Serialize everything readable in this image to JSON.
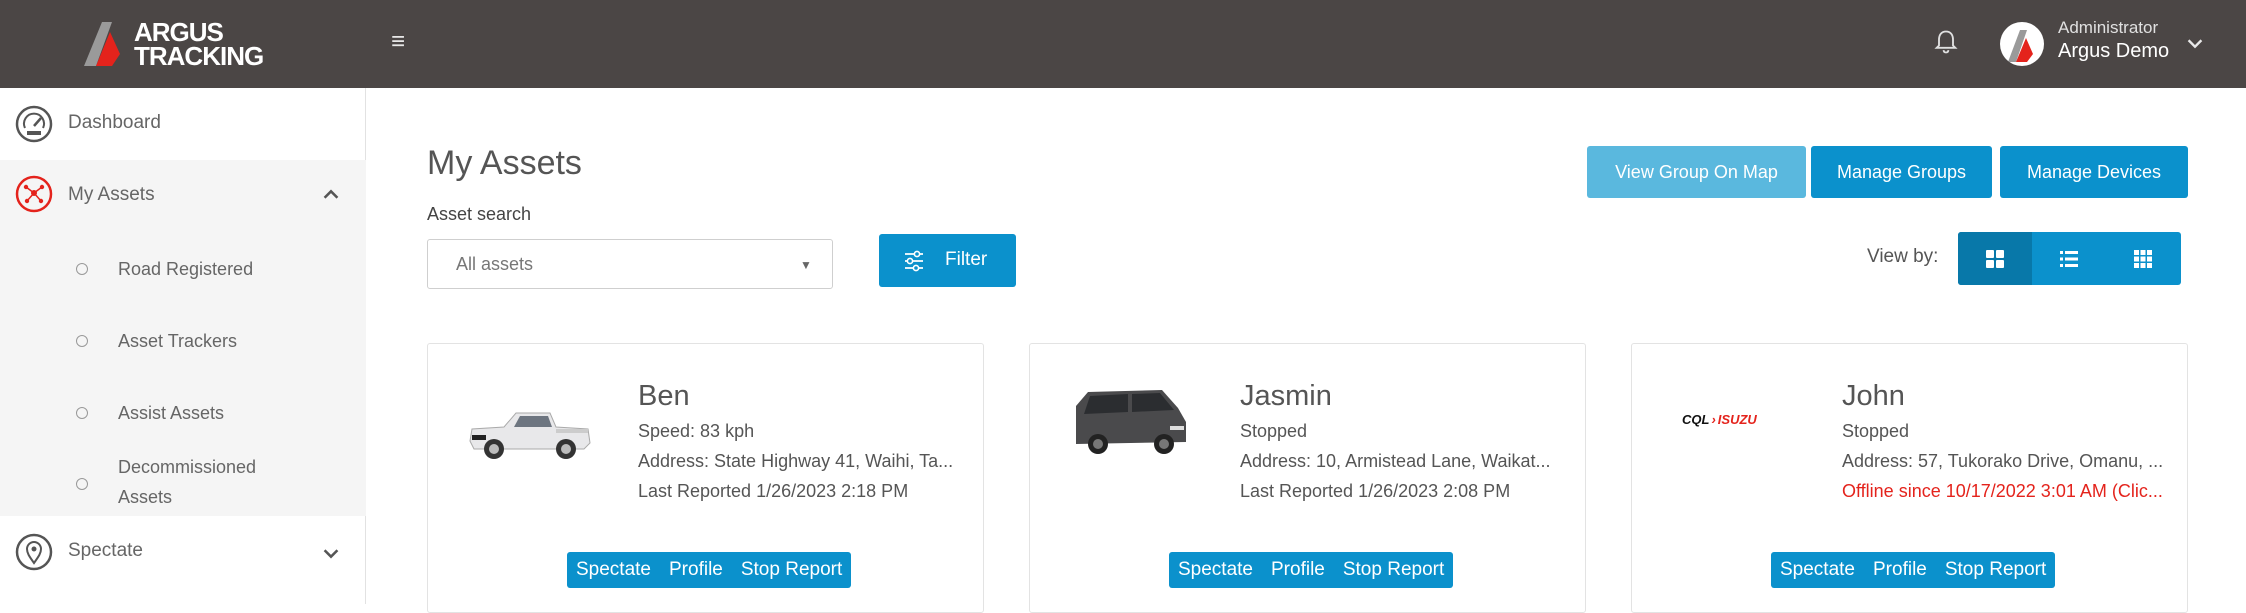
{
  "header": {
    "logo_line1": "ARGUS",
    "logo_line2": "TRACKING",
    "user_role": "Administrator",
    "user_name": "Argus Demo",
    "colors": {
      "bar": "#4b4645",
      "accent": "#e4231c"
    }
  },
  "sidebar": {
    "items": [
      {
        "label": "Dashboard",
        "icon": "speedometer-icon"
      },
      {
        "label": "My Assets",
        "icon": "network-icon",
        "expanded": true
      },
      {
        "label": "Spectate",
        "icon": "map-pin-icon",
        "expanded": false
      }
    ],
    "sub_items": [
      {
        "label": "Road Registered"
      },
      {
        "label": "Asset Trackers"
      },
      {
        "label": "Assist Assets"
      },
      {
        "label": "Decommissioned Assets"
      }
    ]
  },
  "main": {
    "title": "My Assets",
    "search_label": "Asset search",
    "search_value": "All assets",
    "filter_label": "Filter",
    "buttons": {
      "view_group_map": "View Group On Map",
      "manage_groups": "Manage Groups",
      "manage_devices": "Manage Devices"
    },
    "view_by_label": "View by:",
    "view_modes": [
      "grid-large",
      "list",
      "grid-small"
    ],
    "active_view": "grid-large",
    "accent_color": "#0b91cc"
  },
  "cards": [
    {
      "name": "Ben",
      "status": "Speed: 83 kph",
      "address": "Address: State Highway 41, Waihi, Ta...",
      "last": "Last Reported 1/26/2023 2:18 PM",
      "last_alert": false,
      "image": "white-pickup-truck"
    },
    {
      "name": "Jasmin",
      "status": "Stopped",
      "address": "Address: 10, Armistead Lane, Waikat...",
      "last": "Last Reported 1/26/2023 2:08 PM",
      "last_alert": false,
      "image": "grey-van"
    },
    {
      "name": "John",
      "status": "Stopped",
      "address": "Address: 57, Tukorako Drive, Omanu, ...",
      "last": "Offline since 10/17/2022 3:01 AM (Clic...",
      "last_alert": true,
      "image": "cql-isuzu-logo",
      "logo_text_a": "CQL",
      "logo_text_b": "ISUZU"
    }
  ],
  "card_actions": {
    "spectate": "Spectate",
    "profile": "Profile",
    "stop_report": "Stop Report"
  }
}
